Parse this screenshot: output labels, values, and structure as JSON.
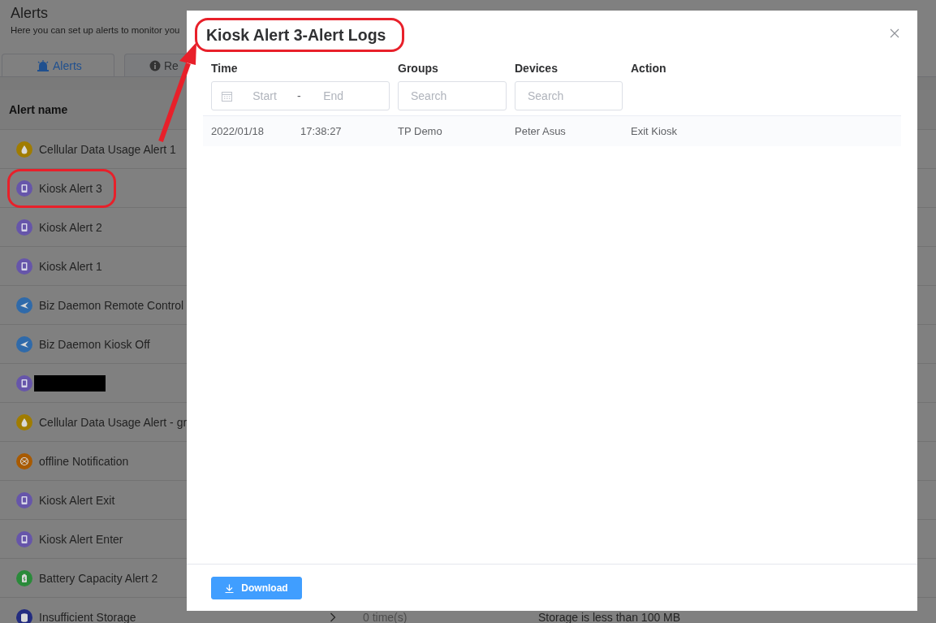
{
  "page": {
    "title": "Alerts",
    "subtitle": "Here you can set up alerts to monitor you",
    "tabs": [
      {
        "label": "Alerts",
        "kind": "siren",
        "selected": true
      },
      {
        "label": "Re",
        "kind": "info",
        "selected": false
      }
    ],
    "table": {
      "columns": [
        "Alert name"
      ],
      "rows": [
        {
          "name": "Cellular Data Usage Alert 1",
          "kind": "drop",
          "color": "#a07c00",
          "redacted": false
        },
        {
          "name": "Kiosk Alert 3",
          "kind": "kiosk",
          "color": "#6655aa",
          "redacted": false
        },
        {
          "name": "Kiosk Alert 2",
          "kind": "kiosk",
          "color": "#6655aa",
          "redacted": false
        },
        {
          "name": "Kiosk Alert 1",
          "kind": "kiosk",
          "color": "#6655aa",
          "redacted": false
        },
        {
          "name": "Biz Daemon Remote Control",
          "kind": "plane",
          "color": "#2f6aaa",
          "redacted": false
        },
        {
          "name": "Biz Daemon Kiosk Off",
          "kind": "plane",
          "color": "#2f6aaa",
          "redacted": false
        },
        {
          "kind": "kiosk",
          "color": "#6655aa",
          "redacted": true
        },
        {
          "name": "Cellular Data Usage Alert - gr",
          "kind": "drop",
          "color": "#a07c00",
          "redacted": false
        },
        {
          "name": "offline Notification",
          "kind": "network",
          "color": "#a85a00",
          "redacted": false
        },
        {
          "name": "Kiosk Alert Exit",
          "kind": "kiosk",
          "color": "#6655aa",
          "redacted": false
        },
        {
          "name": "Kiosk Alert Enter",
          "kind": "kiosk",
          "color": "#6655aa",
          "redacted": false
        },
        {
          "name": "Battery Capacity Alert 2",
          "kind": "battery",
          "color": "#2a8a3a",
          "redacted": false
        },
        {
          "name": "Insufficient Storage",
          "kind": "storage",
          "color": "#232c80",
          "redacted": false,
          "count": "0 time(s)",
          "condition": "Storage is less than 100 MB"
        }
      ]
    }
  },
  "modal": {
    "title": "Kiosk Alert 3-Alert Logs",
    "columns": [
      {
        "label": "Time",
        "kind": "daterange",
        "start_placeholder": "Start",
        "separator": "-",
        "end_placeholder": "End"
      },
      {
        "label": "Groups",
        "kind": "search",
        "placeholder": "Search"
      },
      {
        "label": "Devices",
        "kind": "search",
        "placeholder": "Search"
      },
      {
        "label": "Action",
        "kind": "plain"
      }
    ],
    "rows": [
      {
        "time": {
          "date": "2022/01/18",
          "clock": "17:38:27"
        },
        "group": "TP Demo",
        "device": "Peter Asus",
        "action": "Exit Kiosk"
      }
    ],
    "download_label": "Download"
  }
}
